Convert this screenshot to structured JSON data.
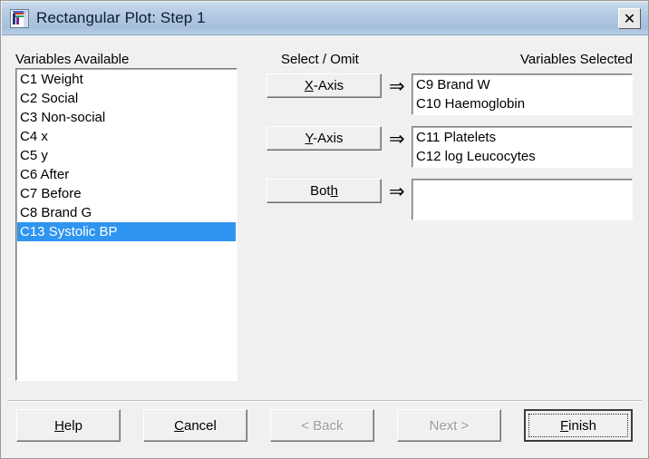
{
  "window": {
    "title": "Rectangular Plot: Step 1",
    "icon": "plot-icon",
    "close_label": "✕",
    "titlebar_color": "#aec6e0",
    "body_color": "#f0f0f0"
  },
  "panels": {
    "available_label": "Variables Available",
    "middle_label": "Select / Omit",
    "selected_label": "Variables Selected"
  },
  "available_variables": {
    "items": [
      {
        "label": "C1 Weight",
        "selected": false
      },
      {
        "label": "C2 Social",
        "selected": false
      },
      {
        "label": "C3 Non-social",
        "selected": false
      },
      {
        "label": "C4 x",
        "selected": false
      },
      {
        "label": "C5 y",
        "selected": false
      },
      {
        "label": "C6 After",
        "selected": false
      },
      {
        "label": "C7 Before",
        "selected": false
      },
      {
        "label": "C8 Brand G",
        "selected": false
      },
      {
        "label": "C13 Systolic BP",
        "selected": true
      }
    ],
    "selection_color": "#2e95f0"
  },
  "assign_buttons": [
    {
      "label": "X-Axis",
      "accel": "X",
      "arrow": "⇒"
    },
    {
      "label": "Y-Axis",
      "accel": "Y",
      "arrow": "⇒"
    },
    {
      "label": "Both",
      "accel": "h",
      "arrow": "⇒"
    }
  ],
  "selected_lists": {
    "x_axis": [
      "C9 Brand W",
      "C10 Haemoglobin"
    ],
    "y_axis": [
      "C11 Platelets",
      "C12 log Leucocytes"
    ],
    "both": []
  },
  "footer_buttons": [
    {
      "label": "Help",
      "accel": "H",
      "enabled": true,
      "default": false
    },
    {
      "label": "Cancel",
      "accel": "C",
      "enabled": true,
      "default": false
    },
    {
      "label": "< Back",
      "accel": "B",
      "enabled": false,
      "default": false
    },
    {
      "label": "Next >",
      "accel": "N",
      "enabled": false,
      "default": false
    },
    {
      "label": "Finish",
      "accel": "F",
      "enabled": true,
      "default": true
    }
  ]
}
